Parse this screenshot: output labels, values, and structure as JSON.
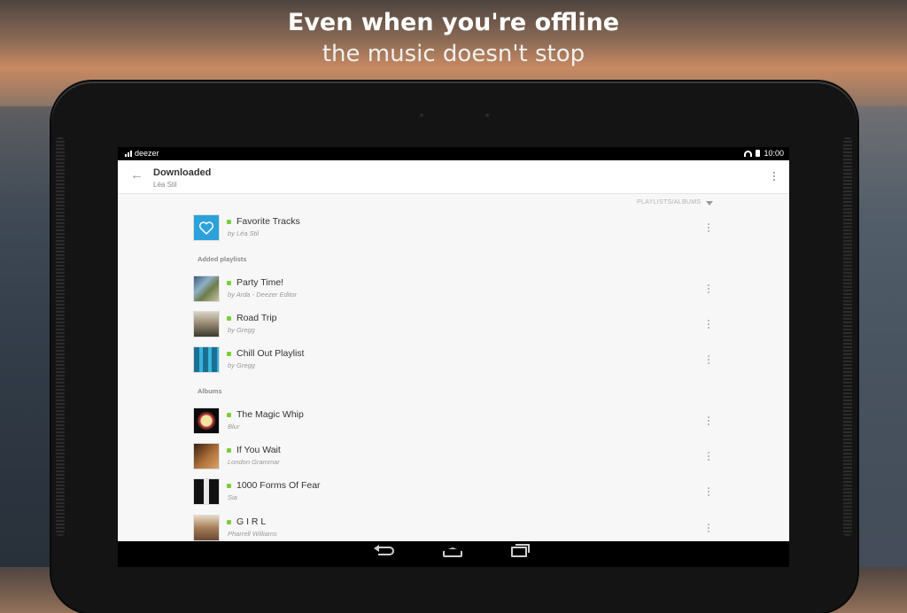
{
  "promo": {
    "headline": "Even when you're offline",
    "subheadline": "the music doesn't stop"
  },
  "statusbar": {
    "app": "deezer",
    "time": "10:00"
  },
  "appbar": {
    "title": "Downloaded",
    "subtitle": "Léa Stil"
  },
  "filter": {
    "label": "PLAYLISTS/ALBUMS"
  },
  "favorites": {
    "title": "Favorite Tracks",
    "subtitle": "by Léa Stil"
  },
  "sections": {
    "playlists": "Added playlists",
    "albums": "Albums"
  },
  "playlists": [
    {
      "title": "Party Time!",
      "subtitle": "by Arda - Deezer Editor"
    },
    {
      "title": "Road Trip",
      "subtitle": "by Gregg"
    },
    {
      "title": "Chill Out Playlist",
      "subtitle": "by Gregg"
    }
  ],
  "albums": [
    {
      "title": "The Magic Whip",
      "subtitle": "Blur"
    },
    {
      "title": "If You Wait",
      "subtitle": "London Grammar"
    },
    {
      "title": "1000 Forms Of Fear",
      "subtitle": "Sia"
    },
    {
      "title": "G I R L",
      "subtitle": "Pharrell Williams"
    }
  ],
  "colors": {
    "download_indicator": "#7bcf3c",
    "favorites_tile": "#2ca1db"
  },
  "icons": {
    "back": "arrow-left-icon",
    "overflow": "more-vertical-icon",
    "favorite": "heart-icon"
  }
}
